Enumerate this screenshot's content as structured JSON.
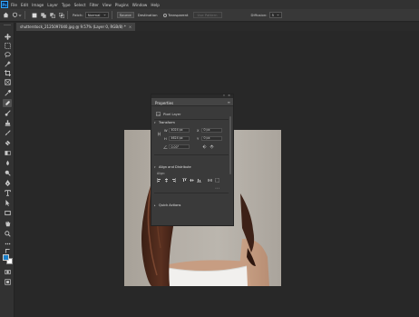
{
  "app": {
    "logo": "Ps"
  },
  "menu": [
    "File",
    "Edit",
    "Image",
    "Layer",
    "Type",
    "Select",
    "Filter",
    "View",
    "Plugins",
    "Window",
    "Help"
  ],
  "options": {
    "patch_label": "Patch:",
    "patch_value": "Normal",
    "source_label": "Source",
    "destination_label": "Destination",
    "transparent_label": "Transparent",
    "use_pattern_label": "Use Pattern",
    "diffusion_label": "Diffusion:",
    "diffusion_value": "5"
  },
  "document_tab": {
    "title": "shutterstock_2125097040.jpg @ 9.57% (Layer 0, RGB/8) *",
    "close": "×"
  },
  "properties": {
    "title": "Properties",
    "menu_icon": "≡",
    "layer_type": "Pixel Layer",
    "transform_heading": "Transform",
    "w_label": "W",
    "w_value": "4024 px",
    "h_label": "H",
    "h_value": "4624 px",
    "x_label": "X",
    "x_value": "0 px",
    "y_label": "Y",
    "y_value": "0 px",
    "angle_value": "0.00°",
    "align_heading": "Align and Distribute",
    "align_sub": "Align:",
    "more": "•••",
    "quick_heading": "Quick Actions"
  },
  "colors": {
    "accent": "#31a8ff",
    "panel_bg": "#3a3a3a",
    "app_bg": "#282828"
  },
  "tool_icons": [
    "move-icon",
    "marquee-icon",
    "lasso-icon",
    "object-select-icon",
    "crop-icon",
    "frame-icon",
    "eyedropper-icon",
    "spot-healing-icon",
    "brush-icon",
    "clone-stamp-icon",
    "history-brush-icon",
    "eraser-icon",
    "gradient-icon",
    "blur-icon",
    "dodge-icon",
    "pen-icon",
    "type-icon",
    "path-select-icon",
    "rectangle-icon",
    "hand-icon",
    "zoom-icon",
    "more-tools-icon",
    "swap-colors-icon",
    "foreground-color-icon",
    "quick-mask-icon",
    "screen-mode-icon"
  ]
}
